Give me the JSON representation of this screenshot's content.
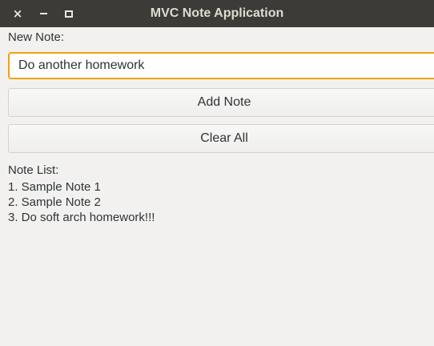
{
  "window": {
    "title": "MVC Note Application",
    "controls": [
      {
        "name": "close",
        "icon": "close-icon"
      },
      {
        "name": "minimize",
        "icon": "minimize-icon"
      },
      {
        "name": "maximize",
        "icon": "maximize-icon"
      }
    ]
  },
  "form": {
    "new_note_label": "New Note:",
    "note_input_value": "Do another homework",
    "add_button_label": "Add Note",
    "clear_button_label": "Clear All"
  },
  "notes": {
    "list_label": "Note List:",
    "items": [
      "1. Sample Note 1",
      "2. Sample Note 2",
      "3. Do soft arch homework!!!"
    ]
  },
  "colors": {
    "titlebar_bg": "#3c3b37",
    "window_bg": "#f2f1f0",
    "input_focus_border": "#f0a30a"
  }
}
